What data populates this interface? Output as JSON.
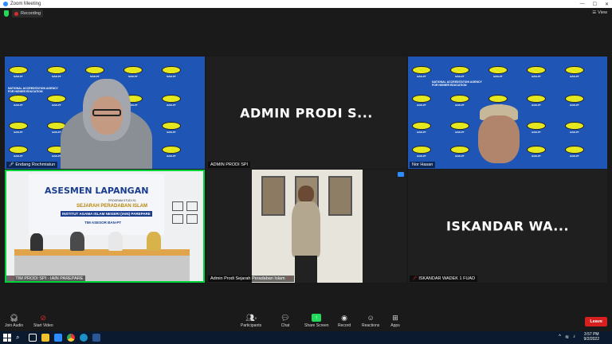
{
  "window": {
    "title": "Zoom Meeting"
  },
  "topbar": {
    "recording_label": "Recording",
    "view_label": "View"
  },
  "tiles": [
    {
      "name": "Endang Rochmiatun",
      "type": "video",
      "mic": "on"
    },
    {
      "name": "ADMIN PRODI SPI",
      "display_text": "ADMIN PRODI S...",
      "type": "name"
    },
    {
      "name": "Nor Hasan",
      "type": "video"
    },
    {
      "name": "TIM PRODI SPI - IAIN PAREPARE",
      "type": "video",
      "mic": "muted"
    },
    {
      "name": "Admin Prodi Sejarah Peradaban Islam",
      "type": "video",
      "mic": "muted"
    },
    {
      "name": "ISKANDAR WADEK 1 FUAD",
      "display_text": "ISKANDAR WA...",
      "type": "name",
      "mic": "muted"
    }
  ],
  "banner": {
    "logo_text": "BAN-PT",
    "agency_line1": "NATIONAL ACCREDITATION AGENCY",
    "agency_line2": "FOR HIGHER EDUCATION"
  },
  "event_poster": {
    "title": "ASESMEN LAPANGAN",
    "subtitle": "PROGRAM STUDI S1",
    "program": "SEJARAH PERADABAN ISLAM",
    "institution": "INSTITUT AGAMA ISLAM NEGERI (IAIN) PAREPARE",
    "team": "TIM ASESOR BAN-PT"
  },
  "controls": [
    {
      "label": "Join Audio",
      "icon": "headphones-icon"
    },
    {
      "label": "Start Video",
      "icon": "video-off-icon"
    },
    {
      "label": "Participants",
      "icon": "participants-icon",
      "count": "9"
    },
    {
      "label": "Chat",
      "icon": "chat-icon"
    },
    {
      "label": "Share Screen",
      "icon": "share-screen-icon"
    },
    {
      "label": "Record",
      "icon": "record-icon"
    },
    {
      "label": "Reactions",
      "icon": "reactions-icon"
    },
    {
      "label": "Apps",
      "icon": "apps-icon"
    }
  ],
  "leave_label": "Leave",
  "taskbar": {
    "time": "3:57 PM",
    "date": "9/2/2022"
  },
  "colors": {
    "accent": "#2d8cff",
    "leave": "#d61f1f",
    "active_speaker": "#00d33c",
    "share": "#23d959"
  }
}
